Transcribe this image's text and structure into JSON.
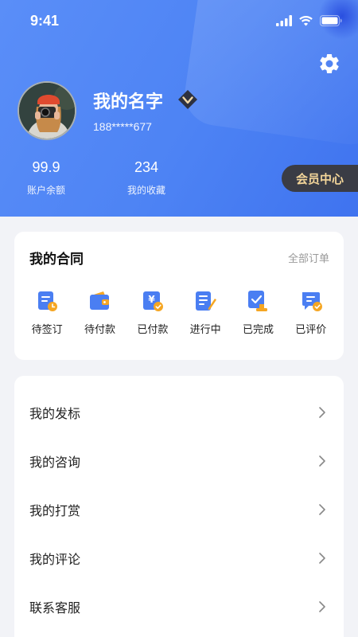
{
  "status_bar": {
    "time": "9:41"
  },
  "profile": {
    "name": "我的名字",
    "phone": "188*****677",
    "stats": [
      {
        "value": "99.9",
        "label": "账户余额"
      },
      {
        "value": "234",
        "label": "我的收藏"
      }
    ],
    "member_button": "会员中心"
  },
  "contract": {
    "title": "我的合同",
    "all_orders": "全部订单",
    "statuses": [
      {
        "label": "待签订",
        "icon": "pending-sign-icon"
      },
      {
        "label": "待付款",
        "icon": "wallet-icon"
      },
      {
        "label": "已付款",
        "icon": "paid-yen-icon"
      },
      {
        "label": "进行中",
        "icon": "in-progress-edit-icon"
      },
      {
        "label": "已完成",
        "icon": "completed-stamp-icon"
      },
      {
        "label": "已评价",
        "icon": "reviewed-comment-icon"
      }
    ]
  },
  "menu": {
    "items": [
      {
        "label": "我的发标"
      },
      {
        "label": "我的咨询"
      },
      {
        "label": "我的打赏"
      },
      {
        "label": "我的评论"
      },
      {
        "label": "联系客服"
      }
    ]
  },
  "colors": {
    "header_blue": "#4d83f4",
    "icon_blue": "#4a7ef2",
    "icon_orange": "#f5a623",
    "member_gold": "#f4d69a",
    "member_bg": "#3a3c45"
  }
}
